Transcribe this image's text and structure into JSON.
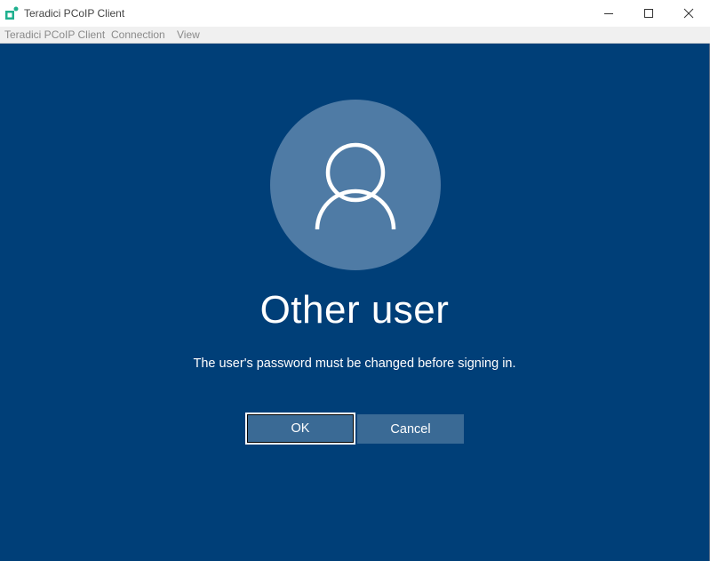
{
  "window": {
    "title": "Teradici PCoIP Client",
    "controls": {
      "minimize_icon": "minimize-icon",
      "maximize_icon": "maximize-icon",
      "close_icon": "close-icon"
    }
  },
  "menubar": {
    "items": [
      {
        "label": "Teradici PCoIP Client"
      },
      {
        "label": "Connection"
      },
      {
        "label": "View"
      }
    ]
  },
  "login": {
    "avatar_icon": "user-icon",
    "username": "Other user",
    "message": "The user's password must be changed before signing in.",
    "ok_label": "OK",
    "cancel_label": "Cancel"
  },
  "colors": {
    "background": "#003f78",
    "avatar": "#4f7ba5",
    "button": "#3a6a95",
    "accent_logo": "#1fb08f"
  }
}
